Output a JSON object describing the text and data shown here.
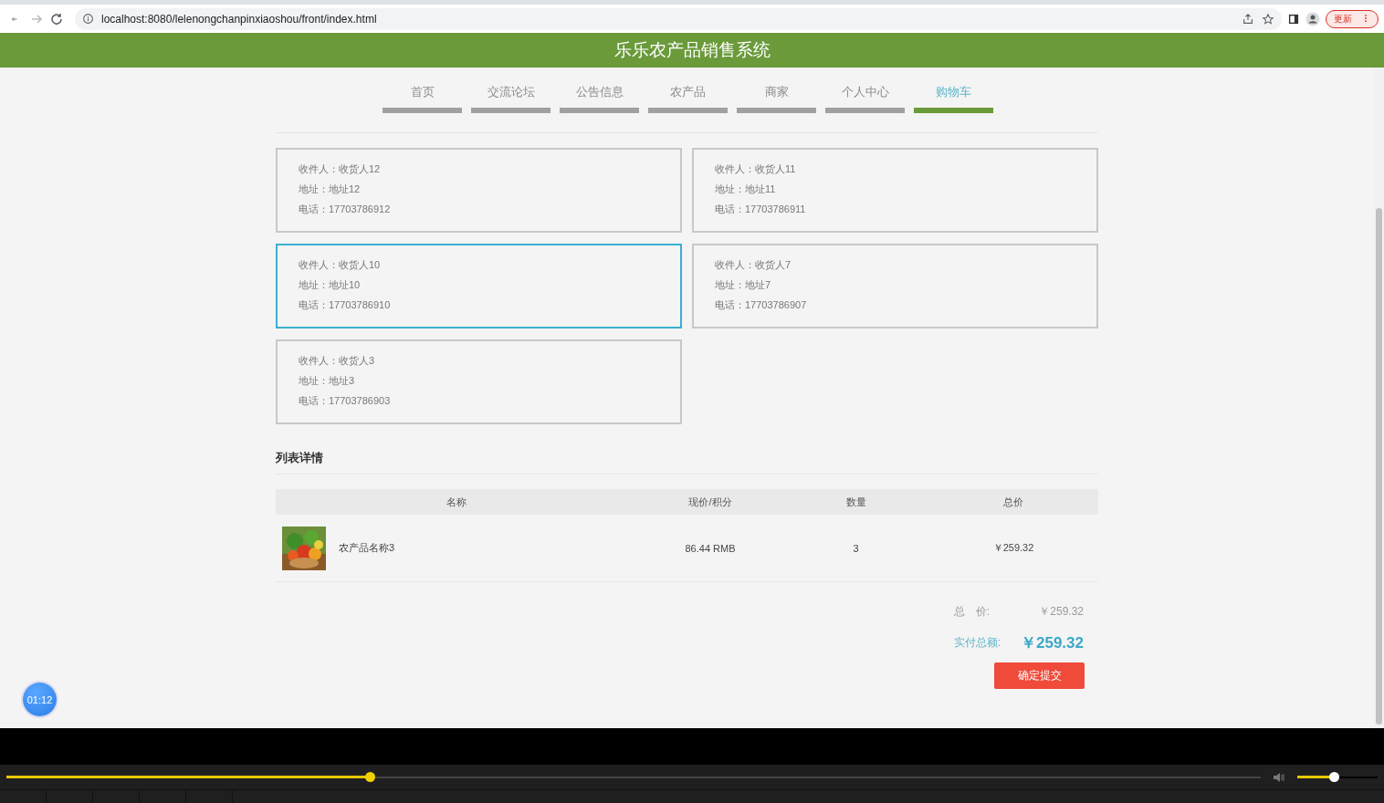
{
  "browser": {
    "url": "localhost:8080/lelenongchanpinxiaoshou/front/index.html",
    "update_button": "更新"
  },
  "header": {
    "title": "乐乐农产品销售系统"
  },
  "nav": [
    {
      "label": "首页",
      "selected": false
    },
    {
      "label": "交流论坛",
      "selected": false
    },
    {
      "label": "公告信息",
      "selected": false
    },
    {
      "label": "农产品",
      "selected": false
    },
    {
      "label": "商家",
      "selected": false
    },
    {
      "label": "个人中心",
      "selected": false
    },
    {
      "label": "购物车",
      "selected": true
    }
  ],
  "addresses": [
    {
      "receiver": "收件人：收货人12",
      "address": "地址：地址12",
      "phone": "电话：17703786912",
      "selected": false
    },
    {
      "receiver": "收件人：收货人11",
      "address": "地址：地址11",
      "phone": "电话：17703786911",
      "selected": false
    },
    {
      "receiver": "收件人：收货人10",
      "address": "地址：地址10",
      "phone": "电话：17703786910",
      "selected": true
    },
    {
      "receiver": "收件人：收货人7",
      "address": "地址：地址7",
      "phone": "电话：17703786907",
      "selected": false
    },
    {
      "receiver": "收件人：收货人3",
      "address": "地址：地址3",
      "phone": "电话：17703786903",
      "selected": false
    }
  ],
  "details": {
    "title": "列表详情",
    "columns": [
      "名称",
      "现价/积分",
      "数量",
      "总价"
    ],
    "rows": [
      {
        "name": "农产品名称3",
        "price": "86.44 RMB",
        "quantity": "3",
        "total": "￥259.32"
      }
    ]
  },
  "totals": {
    "total_label": "总　价:",
    "total_value": "￥259.32",
    "paid_label": "实付总额:",
    "paid_value": "￥259.32"
  },
  "submit_button": "确定提交",
  "timer": "01:12",
  "player": {
    "progress": {
      "level": 0.29
    },
    "volume": {
      "level": 0.45
    }
  }
}
